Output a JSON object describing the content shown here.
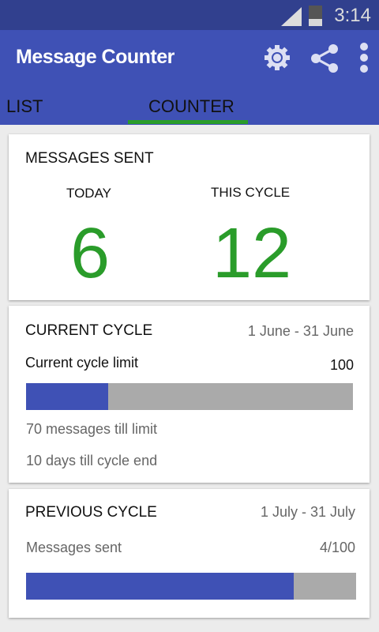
{
  "status": {
    "time": "3:14"
  },
  "appbar": {
    "title": "Message Counter"
  },
  "tabs": [
    {
      "label": "LIST"
    },
    {
      "label": "COUNTER",
      "selected": true
    }
  ],
  "sent": {
    "title": "MESSAGES SENT",
    "today_label": "TODAY",
    "today_value": "6",
    "cycle_label": "THIS CYCLE",
    "cycle_value": "12"
  },
  "current": {
    "title": "CURRENT CYCLE",
    "range": "1 June - 31 June",
    "limit_label": "Current cycle limit",
    "limit_value": "100",
    "progress_percent": 25,
    "till_limit": "70 messages till limit",
    "till_end": "10 days till cycle end"
  },
  "previous": {
    "title": "PREVIOUS CYCLE",
    "range": "1 July - 31 July",
    "sent_label": "Messages sent",
    "sent_value": "4/100",
    "progress_percent": 81
  },
  "colors": {
    "primary": "#3f51b5",
    "accent": "#2a9c2a"
  }
}
